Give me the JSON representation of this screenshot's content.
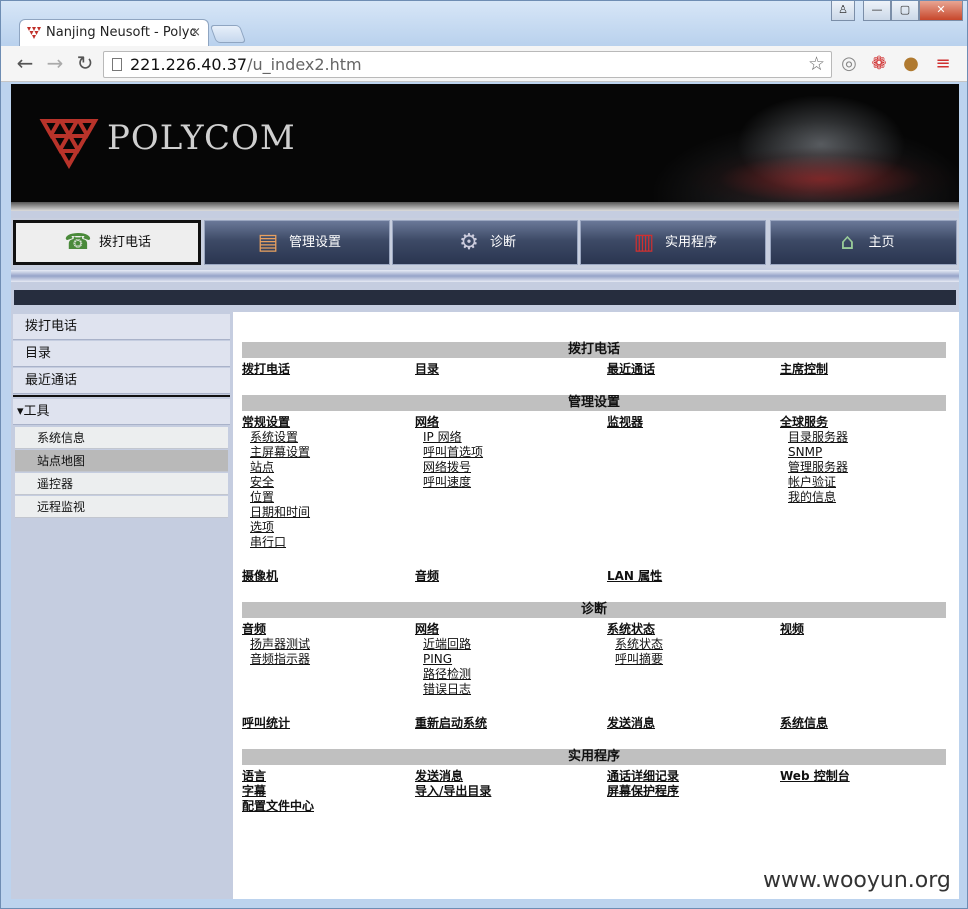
{
  "browser": {
    "tab_title": "Nanjing Neusoft - Polyc",
    "tab_close": "×",
    "url_host": "221.226.40.37",
    "url_path": "/u_index2.htm",
    "controls": {
      "user": "♙",
      "minimize": "—",
      "maximize": "▢",
      "close": "✕"
    }
  },
  "banner": {
    "logo_text": "POLYCOM"
  },
  "menu": [
    {
      "label": "拨打电话",
      "icon": "phone-icon",
      "glyph": "☎"
    },
    {
      "label": "管理设置",
      "icon": "admin-settings-icon",
      "glyph": "▤"
    },
    {
      "label": "诊断",
      "icon": "diagnostics-icon",
      "glyph": "⚙"
    },
    {
      "label": "实用程序",
      "icon": "utilities-icon",
      "glyph": "▥"
    },
    {
      "label": "主页",
      "icon": "home-icon",
      "glyph": "⌂"
    }
  ],
  "sidebar": {
    "items": [
      "拨打电话",
      "目录",
      "最近通话"
    ],
    "tools_label": "▾工具",
    "tools_sub": [
      "系统信息",
      "站点地图",
      "遥控器",
      "远程监视"
    ],
    "selected_sub": "站点地图"
  },
  "sections": {
    "dial": {
      "title": "拨打电话",
      "links": [
        "拨打电话",
        "目录",
        "最近通话",
        "主席控制"
      ]
    },
    "admin": {
      "title": "管理设置",
      "general": {
        "head": "常规设置",
        "items": [
          "系统设置",
          "主屏幕设置",
          "站点",
          "安全",
          "位置",
          "日期和时间",
          "选项",
          "串行口"
        ]
      },
      "network": {
        "head": "网络",
        "items": [
          "IP 网络",
          "呼叫首选项",
          "网络拨号",
          "呼叫速度"
        ]
      },
      "monitor": {
        "head": "监视器"
      },
      "global": {
        "head": "全球服务",
        "items": [
          "目录服务器",
          "SNMP",
          "管理服务器",
          "帐户验证",
          "我的信息"
        ]
      },
      "bottom": [
        "摄像机",
        "音频",
        "LAN 属性"
      ]
    },
    "diag": {
      "title": "诊断",
      "audio": {
        "head": "音频",
        "items": [
          "扬声器测试",
          "音频指示器"
        ]
      },
      "network": {
        "head": "网络",
        "items": [
          "近端回路",
          "PING",
          "路径检测",
          "错误日志"
        ]
      },
      "status": {
        "head": "系统状态",
        "items": [
          "系统状态",
          "呼叫摘要"
        ]
      },
      "video": {
        "head": "视频"
      },
      "bottom": [
        "呼叫统计",
        "重新启动系统",
        "发送消息",
        "系统信息"
      ]
    },
    "util": {
      "title": "实用程序",
      "links": [
        "语言",
        "发送消息",
        "通话详细记录",
        "Web 控制台",
        "字幕",
        "导入/导出目录",
        "屏幕保护程序",
        "配置文件中心"
      ]
    }
  },
  "watermark": "www.wooyun.org"
}
